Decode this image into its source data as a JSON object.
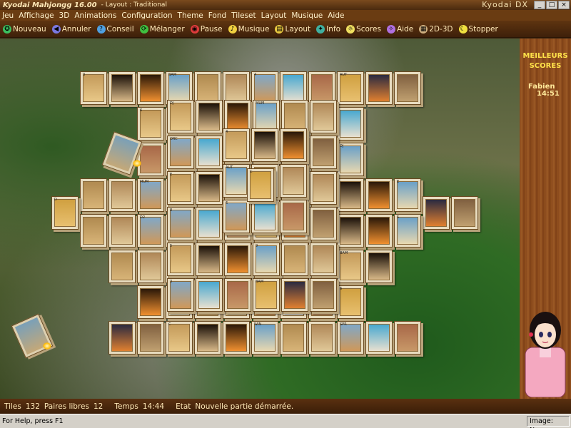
{
  "window": {
    "title": "Kyodai Mahjongg 16.00",
    "subtitle": "- Layout : Traditional",
    "brand": "Kyodai DX",
    "buttons": [
      "_",
      "□",
      "×"
    ]
  },
  "menu": [
    "Jeu",
    "Affichage",
    "3D",
    "Animations",
    "Configuration",
    "Theme",
    "Fond",
    "Tileset",
    "Layout",
    "Musique",
    "Aide"
  ],
  "toolbar": [
    {
      "label": "Nouveau",
      "icon": "new-game-icon",
      "glyph": "✪",
      "color": "#3cc060"
    },
    {
      "label": "Annuler",
      "icon": "undo-icon",
      "glyph": "◀",
      "color": "#7a78e0"
    },
    {
      "label": "Conseil",
      "icon": "hint-icon",
      "glyph": "?",
      "color": "#50a0e0"
    },
    {
      "label": "Mélanger",
      "icon": "shuffle-icon",
      "glyph": "⟳",
      "color": "#40c040"
    },
    {
      "label": "Pause",
      "icon": "pause-icon",
      "glyph": "◉",
      "color": "#e03c3c"
    },
    {
      "label": "Musique",
      "icon": "music-icon",
      "glyph": "♪",
      "color": "#f0d040"
    },
    {
      "label": "Layout",
      "icon": "layout-icon",
      "glyph": "▤",
      "color": "#e8c840"
    },
    {
      "label": "Info",
      "icon": "info-icon",
      "glyph": "✦",
      "color": "#40b0a0"
    },
    {
      "label": "Scores",
      "icon": "scores-icon",
      "glyph": "☼",
      "color": "#f0e060"
    },
    {
      "label": "Aide",
      "icon": "help-icon",
      "glyph": "✧",
      "color": "#b070e0"
    },
    {
      "label": "2D-3D",
      "icon": "2d-3d-icon",
      "glyph": "▦",
      "color": "#d0b080"
    },
    {
      "label": "Stopper",
      "icon": "stop-icon",
      "glyph": "☾",
      "color": "#f0e040"
    }
  ],
  "sidebar": {
    "highscores_title": [
      "MEILLEURS",
      "SCORES"
    ],
    "player": "Fabien",
    "time": "14:51"
  },
  "info": {
    "tiles_label": "Tiles",
    "tiles_value": "132",
    "pairs_label": "Paires libres",
    "pairs_value": "12",
    "time_label": "Temps",
    "time_value": "14:44",
    "state_label": "Etat",
    "state_value": "Nouvelle partie démarrée."
  },
  "status": {
    "help": "For Help, press F1",
    "image": "Image: None"
  },
  "tile_labels": [
    "3",
    "BAM",
    "4",
    "AUT",
    "6",
    "C",
    "WIN",
    "SPR",
    "D",
    "DJ",
    "MUM",
    "ORC",
    "W",
    "E",
    "D2",
    "8",
    "6",
    "5",
    "9"
  ],
  "tile_palettes": [
    [
      "#c49a5a",
      "#e8c888"
    ],
    [
      "#1a1008",
      "#d8b888"
    ],
    [
      "#2a1808",
      "#f09030"
    ],
    [
      "#6aa0c8",
      "#e8d8b0"
    ],
    [
      "#b08a50",
      "#d8b478"
    ],
    [
      "#b08858",
      "#e0c898"
    ],
    [
      "#80a8c8",
      "#d09858"
    ],
    [
      "#48a8d0",
      "#e8e0d0"
    ],
    [
      "#a86848",
      "#c89868"
    ],
    [
      "#d0a040",
      "#e8c070"
    ],
    [
      "#2a2a40",
      "#e08030"
    ],
    [
      "#806040",
      "#c0a070"
    ]
  ]
}
